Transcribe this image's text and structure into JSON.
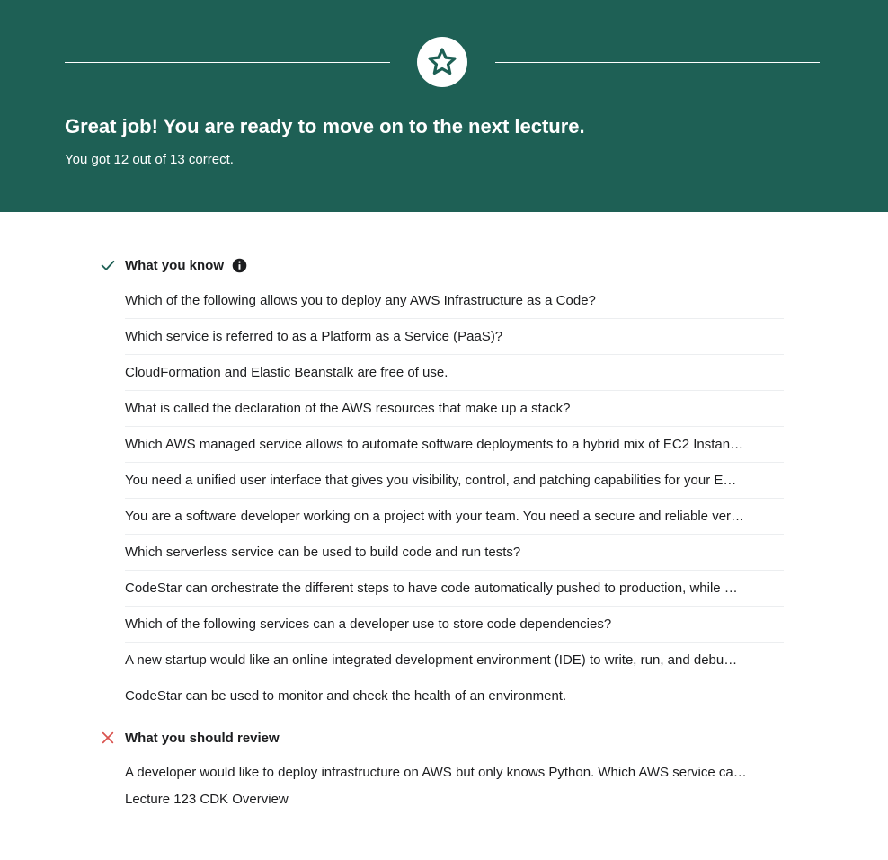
{
  "banner": {
    "headline": "Great job! You are ready to move on to the next lecture.",
    "score_text": "You got 12 out of 13 correct.",
    "badge_icon": "star-icon",
    "background_color": "#1e6055"
  },
  "know": {
    "title": "What you know",
    "status_icon": "check-icon",
    "info_icon": "info-icon",
    "accent_color": "#1e6055",
    "questions": [
      "Which of the following allows you to deploy any AWS Infrastructure as a Code?",
      "Which service is referred to as a Platform as a Service (PaaS)?",
      "CloudFormation and Elastic Beanstalk are free of use.",
      "What is called the declaration of the AWS resources that make up a stack?",
      "Which AWS managed service allows to automate software deployments to a hybrid mix of EC2 Instan…",
      "You need a unified user interface that gives you visibility, control, and patching capabilities for your E…",
      "You are a software developer working on a project with your team. You need a secure and reliable ver…",
      "Which serverless service can be used to build code and run tests?",
      "CodeStar can orchestrate the different steps to have code automatically pushed to production, while …",
      "Which of the following services can a developer use to store code dependencies?",
      "A new startup would like an online integrated development environment (IDE) to write, run, and debu…",
      "CodeStar can be used to monitor and check the health of an environment."
    ]
  },
  "review": {
    "title": "What you should review",
    "status_icon": "x-icon",
    "accent_color": "#d9534f",
    "question": "A developer would like to deploy infrastructure on AWS but only knows Python. Which AWS service ca…",
    "lecture": "Lecture 123 CDK Overview"
  }
}
